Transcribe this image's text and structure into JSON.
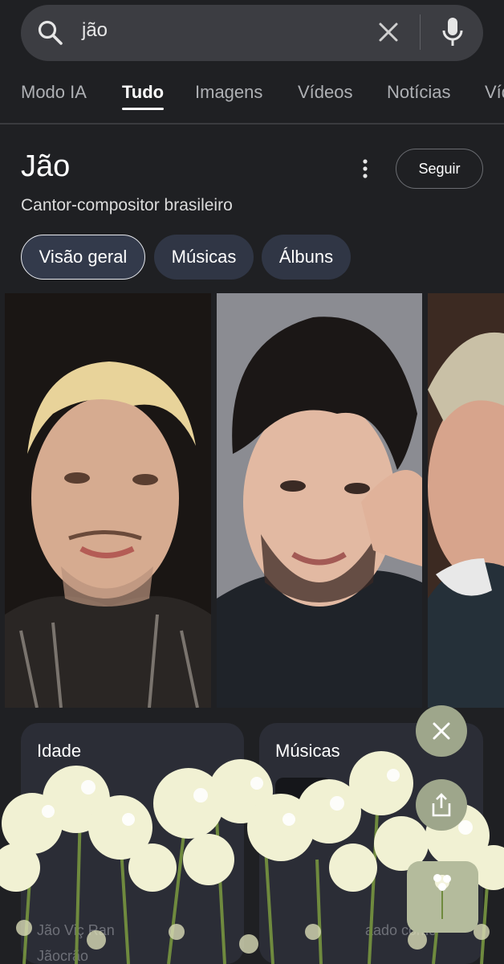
{
  "search": {
    "query": "jão"
  },
  "tabs": [
    {
      "label": "Modo IA",
      "active": false
    },
    {
      "label": "Tudo",
      "active": true
    },
    {
      "label": "Imagens",
      "active": false
    },
    {
      "label": "Vídeos",
      "active": false
    },
    {
      "label": "Notícias",
      "active": false
    },
    {
      "label": "Víd",
      "active": false
    }
  ],
  "entity": {
    "title": "Jão",
    "subtitle": "Cantor-compositor brasileiro",
    "follow_label": "Seguir",
    "menu_icon": "more-vert-icon"
  },
  "chips": [
    {
      "label": "Visão geral",
      "active": true
    },
    {
      "label": "Músicas",
      "active": false
    },
    {
      "label": "Álbuns",
      "active": false
    }
  ],
  "cards": {
    "age_title": "Idade",
    "songs_title": "Músicas",
    "faint_text_1": "Jão Viç Ran",
    "faint_text_2": "Jãocrão",
    "faint_text_3": "aado como"
  },
  "fabs": {
    "close_icon": "close-icon",
    "share_icon": "share-icon",
    "flower_icon": "flower-icon"
  },
  "colors": {
    "background": "#1f2023",
    "search_bar": "#3c3d42",
    "chip": "#303645",
    "card": "#2b2d36",
    "fab": "#9ea68b"
  }
}
